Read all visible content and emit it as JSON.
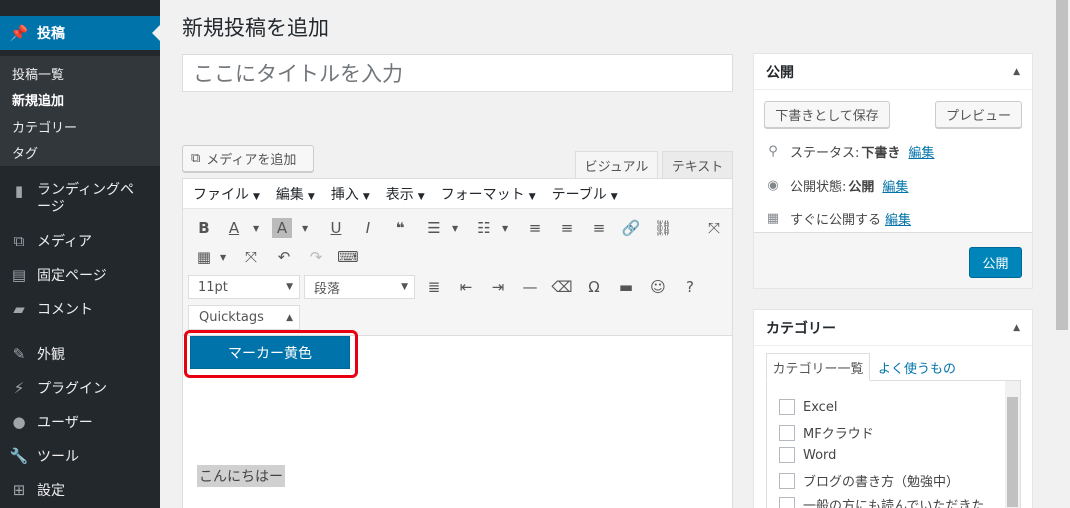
{
  "sidebar": {
    "posts": {
      "label": "投稿",
      "icon": "pin-icon"
    },
    "submenu": [
      "投稿一覧",
      "新規追加",
      "カテゴリー",
      "タグ"
    ],
    "items": [
      {
        "label": "ランディングページ",
        "icon": "landing-page-icon"
      },
      {
        "label": "メディア",
        "icon": "media-icon"
      },
      {
        "label": "固定ページ",
        "icon": "pages-icon"
      },
      {
        "label": "コメント",
        "icon": "comment-icon"
      },
      {
        "label": "外観",
        "icon": "appearance-icon"
      },
      {
        "label": "プラグイン",
        "icon": "plugin-icon"
      },
      {
        "label": "ユーザー",
        "icon": "user-icon"
      },
      {
        "label": "ツール",
        "icon": "tools-icon"
      },
      {
        "label": "設定",
        "icon": "settings-icon"
      }
    ]
  },
  "main": {
    "title": "新規投稿を追加",
    "title_placeholder": "ここにタイトルを入力",
    "add_media": "メディアを追加",
    "tab_visual": "ビジュアル",
    "tab_text": "テキスト"
  },
  "editor": {
    "menubar": [
      "ファイル",
      "編集",
      "挿入",
      "表示",
      "フォーマット",
      "テーブル"
    ],
    "font_size": "11pt",
    "paragraph": "段落",
    "quicktags": "Quicktags",
    "marker_button": "マーカー黄色",
    "content": "こんにちはー"
  },
  "publish_box": {
    "title": "公開",
    "save_draft": "下書きとして保存",
    "preview": "プレビュー",
    "status_label": "ステータス:",
    "status_value": "下書き",
    "visibility_label": "公開状態:",
    "visibility_value": "公開",
    "schedule_label": "すぐに公開する",
    "edit": "編集",
    "publish": "公開"
  },
  "category_box": {
    "title": "カテゴリー",
    "tab_all": "カテゴリー一覧",
    "tab_popular": "よく使うもの",
    "items": [
      "Excel",
      "MFクラウド",
      "Word",
      "ブログの書き方（勉強中）",
      "一般の方にも読んでいただきた"
    ]
  },
  "colors": {
    "sidebar_bg": "#23282d",
    "accent": "#0073aa",
    "highlight_outline": "#e60012"
  }
}
